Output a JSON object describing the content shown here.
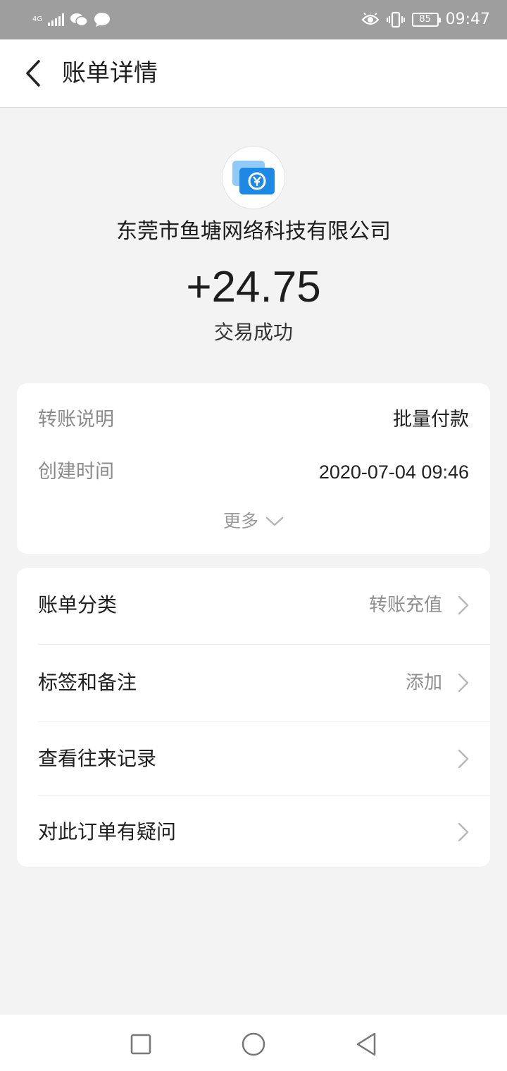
{
  "status_bar": {
    "network_label": "4G",
    "battery_level": "85",
    "time": "09:47"
  },
  "header": {
    "title": "账单详情"
  },
  "summary": {
    "merchant_name": "东莞市鱼塘网络科技有限公司",
    "amount": "+24.75",
    "status": "交易成功"
  },
  "details": {
    "rows": [
      {
        "label": "转账说明",
        "value": "批量付款"
      },
      {
        "label": "创建时间",
        "value": "2020-07-04 09:46"
      }
    ],
    "more_label": "更多"
  },
  "menu": {
    "items": [
      {
        "label": "账单分类",
        "value": "转账充值"
      },
      {
        "label": "标签和备注",
        "value": "添加"
      },
      {
        "label": "查看往来记录",
        "value": ""
      },
      {
        "label": "对此订单有疑问",
        "value": ""
      }
    ]
  },
  "colors": {
    "status_bar": "#9e9e9e",
    "background": "#f3f3f3",
    "icon_blue": "#1e88e5",
    "secondary_text": "#8a8a8a"
  }
}
